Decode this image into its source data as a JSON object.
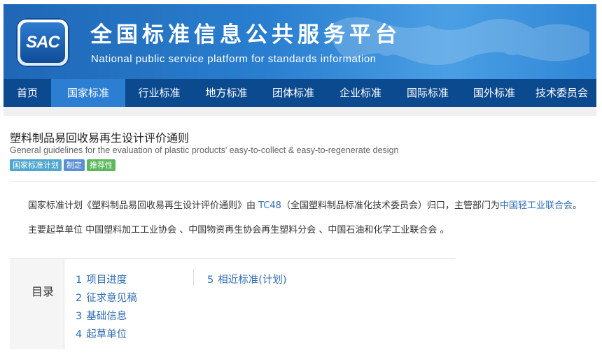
{
  "header": {
    "logo_text": "SAC",
    "title_cn": "全国标准信息公共服务平台",
    "title_en": "National public service platform  for standards information"
  },
  "nav": {
    "items": [
      {
        "label": "首页"
      },
      {
        "label": "国家标准"
      },
      {
        "label": "行业标准"
      },
      {
        "label": "地方标准"
      },
      {
        "label": "团体标准"
      },
      {
        "label": "企业标准"
      },
      {
        "label": "国际标准"
      },
      {
        "label": "国外标准"
      },
      {
        "label": "技术委员会"
      }
    ],
    "active": "国家标准"
  },
  "standard": {
    "title": "塑料制品易回收易再生设计评价通则",
    "title_en": "General guidelines for the evaluation of plastic products' easy-to-collect & easy-to-regenerate design",
    "badges": [
      {
        "label": "国家标准计划",
        "color": "#4fa6cf"
      },
      {
        "label": "制定",
        "color": "#5b8fd1"
      },
      {
        "label": "推荐性",
        "color": "#5cb85c"
      }
    ]
  },
  "summary": {
    "p1_prefix": "国家标准计划《塑料制品易回收易再生设计评价通则》由 ",
    "p1_tc": "TC48",
    "p1_mid": "（全国塑料制品标准化技术委员会）归口，主管部门为",
    "p1_dept": "中国轻工业联合会",
    "p1_suffix": "。",
    "p2": "主要起草单位 中国塑料加工工业协会 、中国物资再生协会再生塑料分会 、中国石油和化学工业联合会 。"
  },
  "toc": {
    "label": "目录",
    "col1": [
      {
        "num": "1",
        "label": "项目进度"
      },
      {
        "num": "2",
        "label": "征求意见稿"
      },
      {
        "num": "3",
        "label": "基础信息"
      },
      {
        "num": "4",
        "label": "起草单位"
      }
    ],
    "col2": [
      {
        "num": "5",
        "label": "相近标准(计划)"
      }
    ]
  },
  "colors": {
    "nav_bg": "#0c4a8f",
    "nav_active": "#2b7ed1",
    "link": "#2f6db5"
  }
}
